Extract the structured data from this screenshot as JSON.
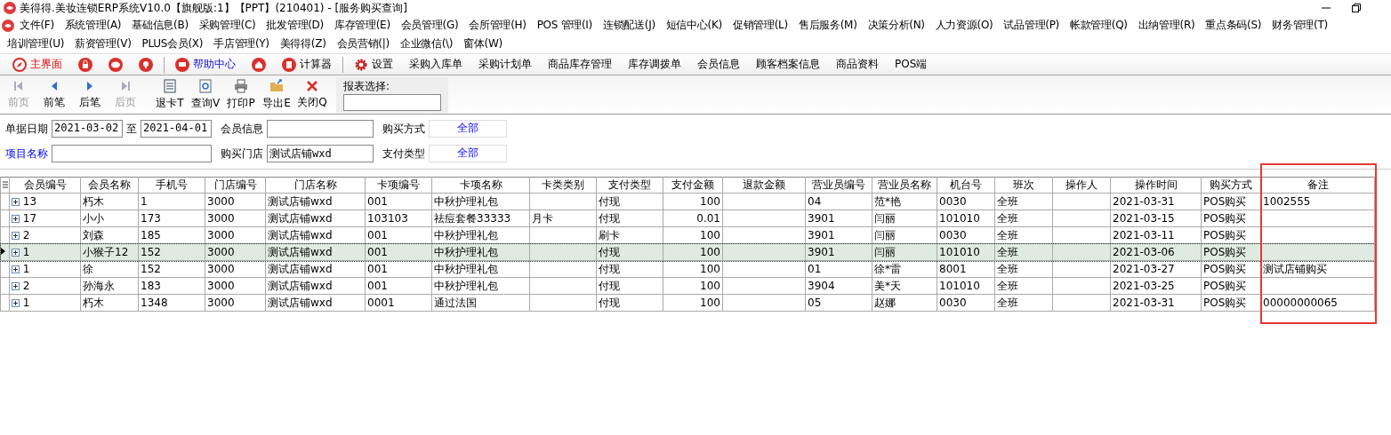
{
  "window": {
    "title": "美得得.美妆连锁ERP系统V10.0【旗舰版:1】【PPT】(210401) - [服务购买查询]"
  },
  "menu_rows": [
    [
      "文件(F)",
      "系统管理(A)",
      "基础信息(B)",
      "采购管理(C)",
      "批发管理(D)",
      "库存管理(E)",
      "会员管理(G)",
      "会所管理(H)",
      "POS 管理(I)",
      "连锁配送(J)",
      "短信中心(K)",
      "促销管理(L)",
      "售后服务(M)",
      "决策分析(N)",
      "人力资源(O)",
      "试品管理(P)",
      "帐款管理(Q)",
      "出纳管理(R)",
      "重点条码(S)",
      "财务管理(T)"
    ],
    [
      "培训管理(U)",
      "薪资管理(V)",
      "PLUS会员(X)",
      "手店管理(Y)",
      "美得得(Z)",
      "会员营销(|)",
      "企业微信(\\)",
      "窗体(W)"
    ]
  ],
  "quickbar": [
    {
      "kind": "compass",
      "label": "主界面"
    },
    {
      "kind": "lock"
    },
    {
      "kind": "chat"
    },
    {
      "kind": "bulb"
    },
    {
      "kind": "monitor",
      "label": "帮助中心"
    },
    {
      "kind": "home"
    },
    {
      "kind": "calc",
      "label": "计算器"
    },
    {
      "kind": "gear",
      "label": "设置"
    },
    {
      "kind": "none",
      "label": "采购入库单"
    },
    {
      "kind": "none",
      "label": "采购计划单"
    },
    {
      "kind": "none",
      "label": "商品库存管理"
    },
    {
      "kind": "none",
      "label": "库存调拨单"
    },
    {
      "kind": "none",
      "label": "会员信息"
    },
    {
      "kind": "none",
      "label": "顾客档案信息"
    },
    {
      "kind": "none",
      "label": "商品资料"
    },
    {
      "kind": "none",
      "label": "POS端"
    }
  ],
  "toolbar": [
    {
      "kind": "first",
      "label": "前页",
      "disabled": true
    },
    {
      "kind": "prev",
      "label": "前笔",
      "disabled": false
    },
    {
      "kind": "next",
      "label": "后笔",
      "disabled": false
    },
    {
      "kind": "last",
      "label": "后页",
      "disabled": true
    },
    {
      "kind": "doc",
      "label": "退卡T",
      "disabled": false
    },
    {
      "kind": "search",
      "label": "查询V",
      "disabled": false
    },
    {
      "kind": "print",
      "label": "打印P",
      "disabled": false
    },
    {
      "kind": "export",
      "label": "导出E",
      "disabled": false
    },
    {
      "kind": "close",
      "label": "关闭Q",
      "disabled": false
    }
  ],
  "report_select": {
    "label": "报表选择:"
  },
  "filters": {
    "date_label": "单据日期",
    "date_from": "2021-03-02",
    "to_label": "至",
    "date_to": "2021-04-01",
    "member_label": "会员信息",
    "buy_method_label": "购买方式",
    "buy_method": "全部",
    "item_label": "项目名称",
    "store_label": "购买门店",
    "store": "测试店铺wxd",
    "pay_type_label": "支付类型",
    "pay_type": "全部"
  },
  "table": {
    "columns": [
      "会员编号",
      "会员名称",
      "手机号",
      "门店编号",
      "门店名称",
      "卡项编号",
      "卡项名称",
      "卡类类别",
      "支付类型",
      "支付金额",
      "退款金额",
      "营业员编号",
      "营业员名称",
      "机台号",
      "班次",
      "操作人",
      "操作时间",
      "购买方式",
      "备注"
    ],
    "rows": [
      {
        "selected": false,
        "cells": [
          "13",
          "朽木",
          "1",
          "3000",
          "测试店铺wxd",
          "001",
          "中秋护理礼包",
          "",
          "付现",
          "100",
          "",
          "04",
          "范*艳",
          "0030",
          "全班",
          "",
          "2021-03-31",
          "POS购买",
          "1002555"
        ]
      },
      {
        "selected": false,
        "cells": [
          "17",
          "小小",
          "173",
          "3000",
          "测试店铺wxd",
          "103103",
          "祛痘套餐33333",
          "月卡",
          "付现",
          "0.01",
          "",
          "3901",
          "闫丽",
          "101010",
          "全班",
          "",
          "2021-03-15",
          "POS购买",
          ""
        ]
      },
      {
        "selected": false,
        "cells": [
          "2",
          "刘森",
          "185",
          "3000",
          "测试店铺wxd",
          "001",
          "中秋护理礼包",
          "",
          "刷卡",
          "100",
          "",
          "3901",
          "闫丽",
          "0030",
          "全班",
          "",
          "2021-03-11",
          "POS购买",
          ""
        ]
      },
      {
        "selected": true,
        "cells": [
          "1",
          "小猴子12",
          "152",
          "3000",
          "测试店铺wxd",
          "001",
          "中秋护理礼包",
          "",
          "付现",
          "100",
          "",
          "3901",
          "闫丽",
          "101010",
          "全班",
          "",
          "2021-03-06",
          "POS购买",
          ""
        ]
      },
      {
        "selected": false,
        "cells": [
          "1",
          "徐",
          "152",
          "3000",
          "测试店铺wxd",
          "001",
          "中秋护理礼包",
          "",
          "付现",
          "100",
          "",
          "01",
          "徐*雷",
          "8001",
          "全班",
          "",
          "2021-03-27",
          "POS购买",
          "测试店铺购买"
        ]
      },
      {
        "selected": false,
        "cells": [
          "2",
          "孙海永",
          "183",
          "3000",
          "测试店铺wxd",
          "001",
          "中秋护理礼包",
          "",
          "付现",
          "100",
          "",
          "3904",
          "美*天",
          "101010",
          "全班",
          "",
          "2021-03-25",
          "POS购买",
          ""
        ]
      },
      {
        "selected": false,
        "cells": [
          "1",
          "朽木",
          "1348",
          "3000",
          "测试店铺wxd",
          "0001",
          "通过法国",
          "",
          "付现",
          "100",
          "",
          "05",
          "赵娜",
          "0030",
          "全班",
          "",
          "2021-03-31",
          "POS购买",
          "00000000065"
        ]
      }
    ]
  }
}
